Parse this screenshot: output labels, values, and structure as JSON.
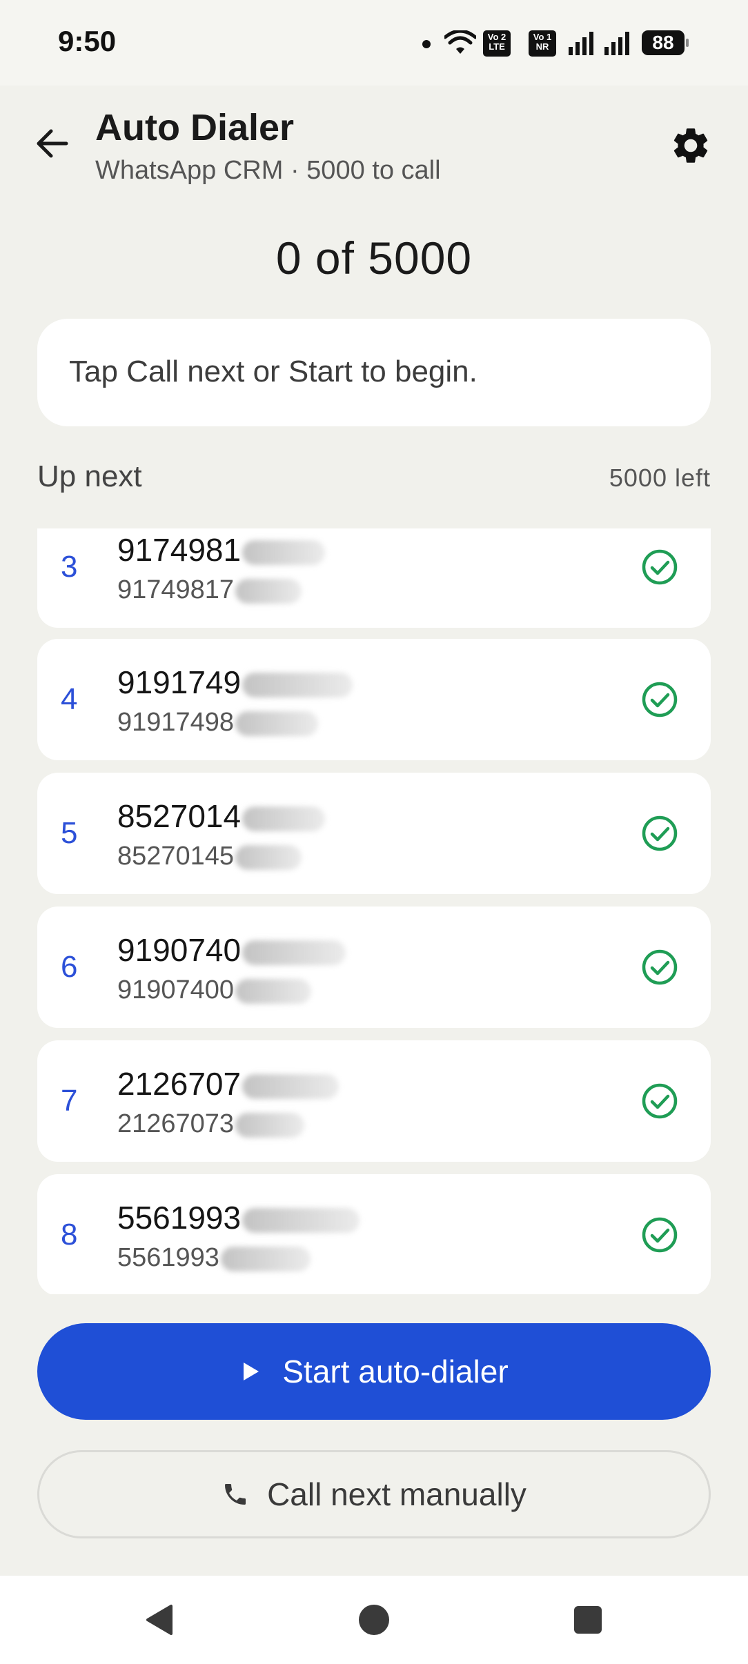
{
  "status_bar": {
    "time": "9:50",
    "volte1_top": "Vo 2",
    "volte1_bottom": "LTE",
    "volte2_top": "Vo 1",
    "volte2_bottom": "NR",
    "battery": "88"
  },
  "header": {
    "title": "Auto Dialer",
    "subtitle": "WhatsApp CRM · 5000 to call",
    "back_icon": "arrow-left-icon",
    "settings_icon": "gear-icon"
  },
  "progress": {
    "text": "0 of 5000"
  },
  "hint": {
    "text": "Tap Call next or Start to begin."
  },
  "queue": {
    "label": "Up next",
    "remaining": "5000 left",
    "items": [
      {
        "index": "3",
        "primary": "9174981",
        "secondary": "91749817"
      },
      {
        "index": "4",
        "primary": "9191749",
        "secondary": "91917498"
      },
      {
        "index": "5",
        "primary": "8527014",
        "secondary": "85270145"
      },
      {
        "index": "6",
        "primary": "9190740",
        "secondary": "91907400"
      },
      {
        "index": "7",
        "primary": "2126707",
        "secondary": "21267073"
      },
      {
        "index": "8",
        "primary": "5561993",
        "secondary": "5561993"
      }
    ],
    "status_icon": "check-circle-icon"
  },
  "actions": {
    "start_label": "Start auto-dialer",
    "manual_label": "Call next manually"
  },
  "colors": {
    "accent": "#1f4fd6",
    "index_blue": "#2c50d8",
    "check_green": "#1f9d55",
    "background": "#f1f1ec"
  }
}
